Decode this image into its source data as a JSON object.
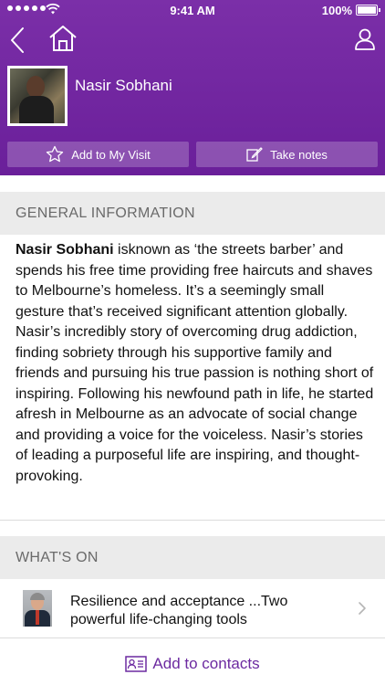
{
  "status_bar": {
    "time": "9:41 AM",
    "battery": "100%",
    "signal_dots": 5
  },
  "navbar": {
    "back_icon": "chevron-left-icon",
    "home_icon": "home-icon",
    "profile_icon": "person-icon"
  },
  "profile": {
    "name": "Nasir Sobhani"
  },
  "actions": {
    "add_visit_label": "Add to My Visit",
    "take_notes_label": "Take notes"
  },
  "general": {
    "header": "GENERAL INFORMATION",
    "bio_name": "Nasir Sobhani",
    "bio_text": " isknown as ‘the streets barber’ and spends his free time providing free haircuts and shaves to Melbourne’s homeless. It’s a seemingly small gesture that’s received significant attention globally. Nasir’s incredibly story of overcoming drug addiction, finding sobriety through his supportive family and friends and pursuing his true passion is nothing short of inspiring. Following his newfound path in life, he started afresh in Melbourne as an advocate of social change and providing a voice for the voiceless. Nasir’s stories of leading a purposeful life are inspiring, and thought-provoking."
  },
  "whats_on": {
    "header": "WHAT'S ON",
    "events": [
      {
        "title": "Resilience and acceptance ...Two powerful life-changing tools"
      }
    ]
  },
  "footer": {
    "add_contacts_label": "Add to contacts"
  },
  "colors": {
    "brand_purple": "#6a1f9a",
    "link_purple": "#6c2aa0",
    "section_bg": "#ebebeb"
  }
}
